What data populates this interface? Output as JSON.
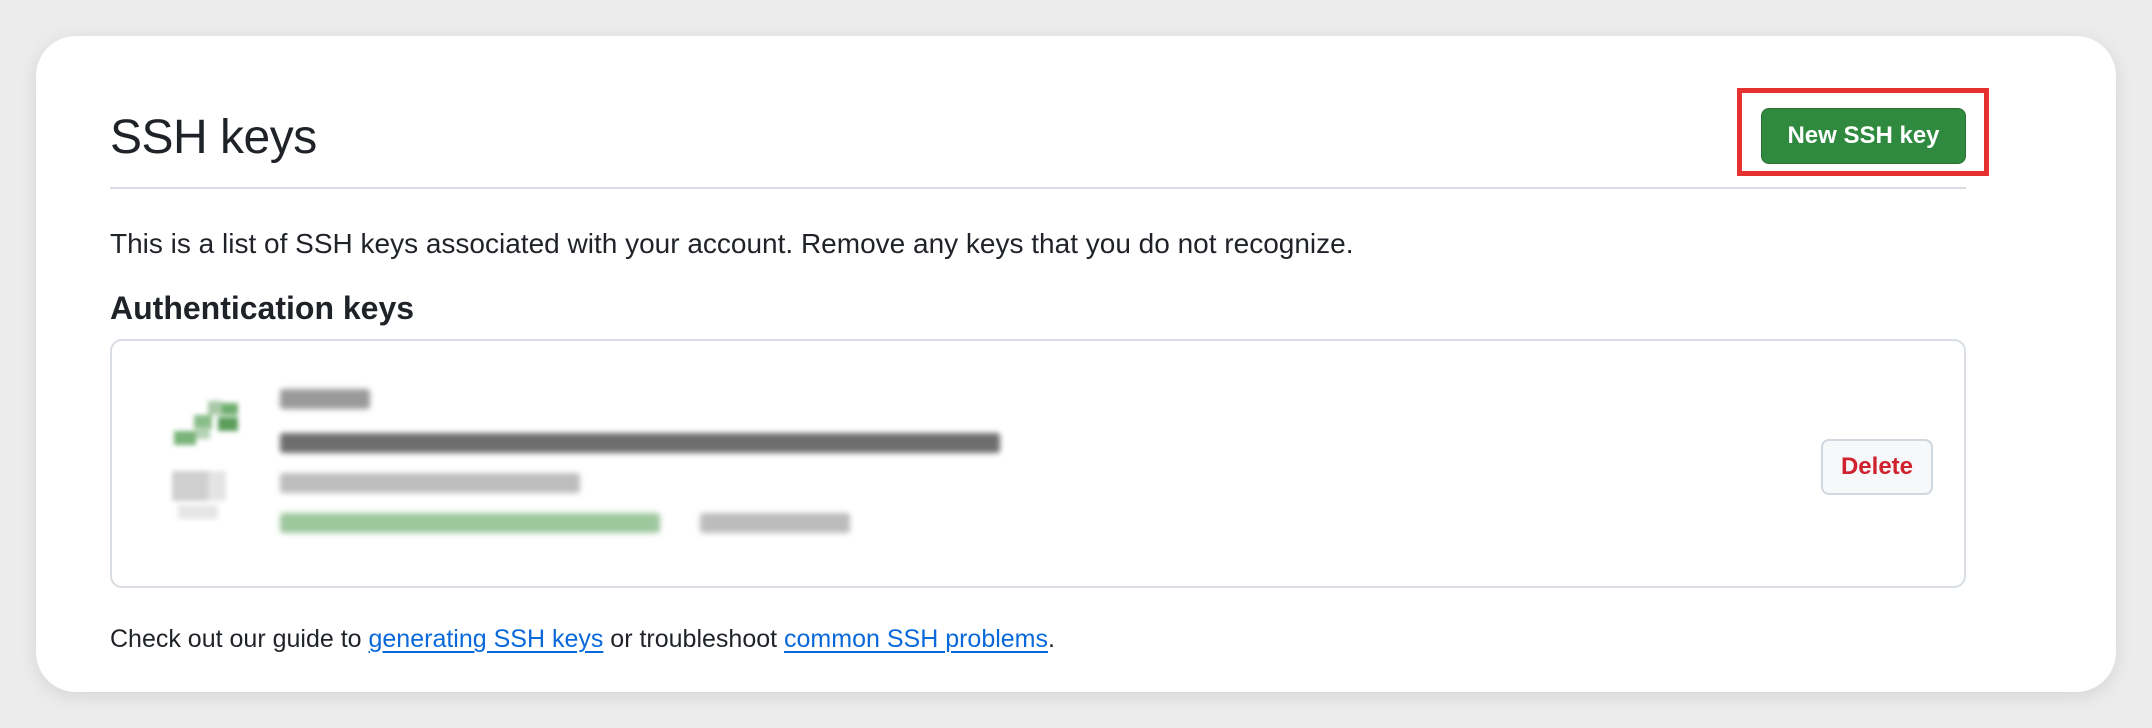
{
  "header": {
    "title": "SSH keys",
    "new_key_button": "New SSH key"
  },
  "description": "This is a list of SSH keys associated with your account. Remove any keys that you do not recognize.",
  "authentication": {
    "heading": "Authentication keys",
    "key": {
      "icon": "key-icon",
      "details_redacted": true,
      "delete_button": "Delete"
    }
  },
  "footer": {
    "prefix": "Check out our guide to ",
    "link1": "generating SSH keys",
    "middle": " or troubleshoot ",
    "link2": "common SSH problems",
    "suffix": "."
  },
  "colors": {
    "primary_button": "#2f8a3f",
    "danger_text": "#cf222e",
    "link": "#0969da",
    "highlight": "#e5312f"
  }
}
